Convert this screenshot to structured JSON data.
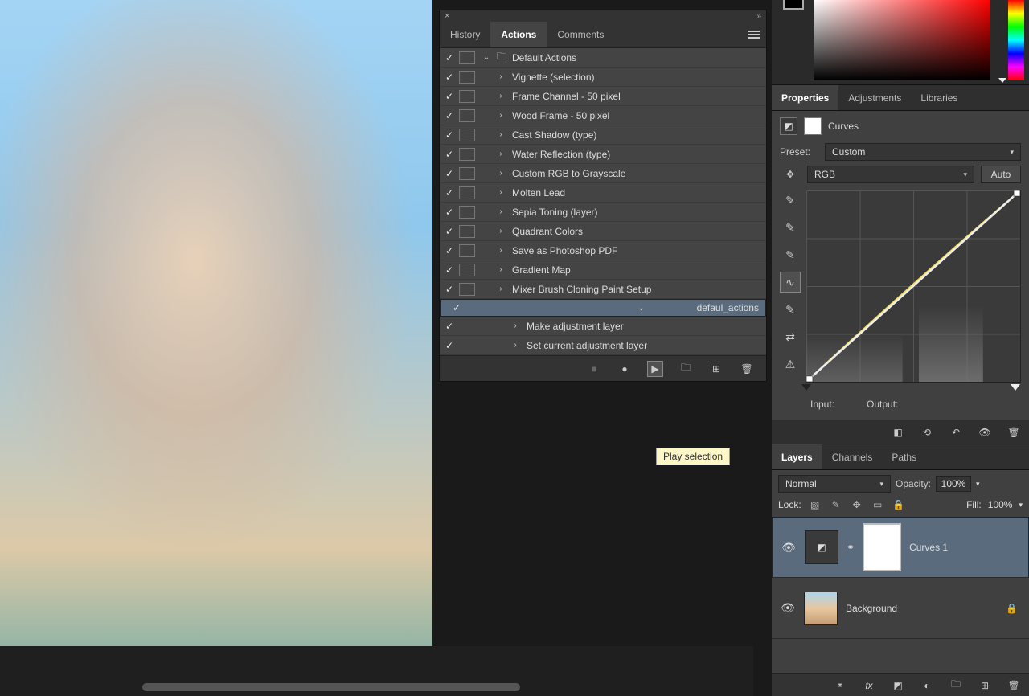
{
  "canvas": {
    "scrollbar_present": true
  },
  "actions_panel": {
    "tabs": {
      "history": "History",
      "actions": "Actions",
      "comments": "Comments",
      "active": "actions"
    },
    "tooltip": "Play selection",
    "items": [
      {
        "indent": 0,
        "toggle": true,
        "btn": true,
        "arrow": "down",
        "folder": true,
        "label": "Default Actions",
        "selected": false
      },
      {
        "indent": 1,
        "toggle": true,
        "btn": true,
        "arrow": "right",
        "label": "Vignette (selection)"
      },
      {
        "indent": 1,
        "toggle": true,
        "btn": true,
        "arrow": "right",
        "label": "Frame Channel - 50 pixel"
      },
      {
        "indent": 1,
        "toggle": true,
        "btn": true,
        "arrow": "right",
        "label": "Wood Frame - 50 pixel"
      },
      {
        "indent": 1,
        "toggle": true,
        "btn": true,
        "arrow": "right",
        "label": "Cast Shadow (type)"
      },
      {
        "indent": 1,
        "toggle": true,
        "btn": true,
        "arrow": "right",
        "label": "Water Reflection (type)"
      },
      {
        "indent": 1,
        "toggle": true,
        "btn": true,
        "arrow": "right",
        "label": "Custom RGB to Grayscale"
      },
      {
        "indent": 1,
        "toggle": true,
        "btn": true,
        "arrow": "right",
        "label": "Molten Lead"
      },
      {
        "indent": 1,
        "toggle": true,
        "btn": true,
        "arrow": "right",
        "label": "Sepia Toning (layer)"
      },
      {
        "indent": 1,
        "toggle": true,
        "btn": true,
        "arrow": "right",
        "label": "Quadrant Colors"
      },
      {
        "indent": 1,
        "toggle": true,
        "btn": true,
        "arrow": "right",
        "label": "Save as Photoshop PDF"
      },
      {
        "indent": 1,
        "toggle": true,
        "btn": true,
        "arrow": "right",
        "label": "Gradient Map"
      },
      {
        "indent": 1,
        "toggle": true,
        "btn": true,
        "arrow": "right",
        "label": "Mixer Brush Cloning Paint Setup"
      },
      {
        "indent": 1,
        "toggle": true,
        "btn": false,
        "arrow": "down",
        "label": "defaul_actions",
        "selected": true
      },
      {
        "indent": 2,
        "toggle": true,
        "btn": false,
        "arrow": "right",
        "label": "Make adjustment layer"
      },
      {
        "indent": 2,
        "toggle": true,
        "btn": false,
        "arrow": "right",
        "label": "Set current adjustment layer"
      }
    ],
    "footer_icons": {
      "stop": "■",
      "record": "●",
      "play": "▶",
      "folder": "🗀",
      "new": "⊞",
      "trash": "🗑"
    }
  },
  "right_panel": {
    "tabs1": {
      "properties": "Properties",
      "adjustments": "Adjustments",
      "libraries": "Libraries",
      "active": "properties"
    },
    "curves": {
      "title": "Curves",
      "preset_label": "Preset:",
      "preset_value": "Custom",
      "channel_value": "RGB",
      "auto_label": "Auto",
      "input_label": "Input:",
      "output_label": "Output:"
    },
    "tabs2": {
      "layers": "Layers",
      "channels": "Channels",
      "paths": "Paths",
      "active": "layers"
    },
    "layers": {
      "blend_mode": "Normal",
      "opacity_label": "Opacity:",
      "opacity_value": "100%",
      "lock_label": "Lock:",
      "fill_label": "Fill:",
      "fill_value": "100%",
      "items": [
        {
          "name": "Curves 1",
          "selected": true,
          "type": "adjustment",
          "visible": true,
          "linked": true
        },
        {
          "name": "Background",
          "selected": false,
          "type": "image",
          "visible": true,
          "locked": true
        }
      ]
    }
  }
}
